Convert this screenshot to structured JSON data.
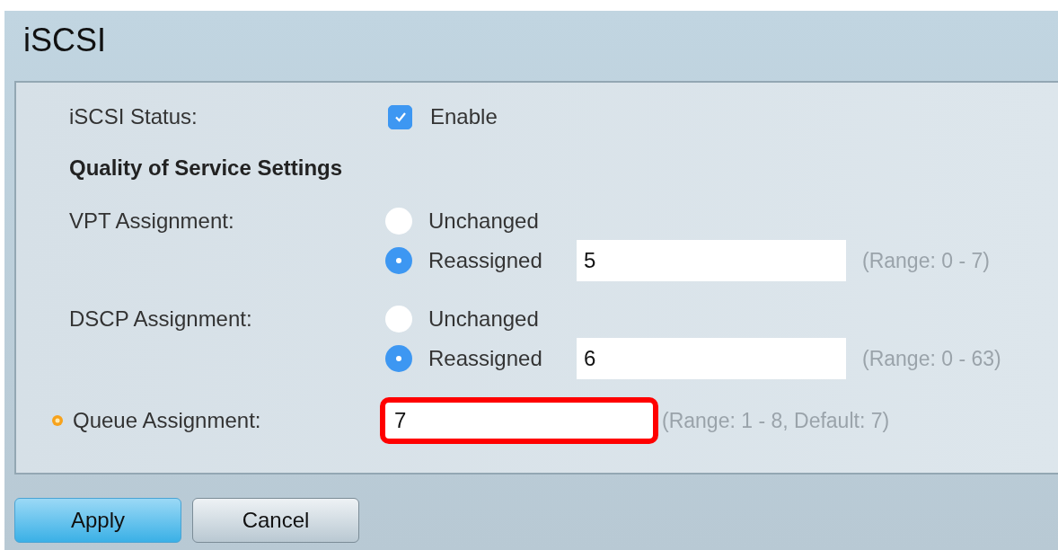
{
  "title": "iSCSI",
  "status": {
    "label": "iSCSI Status:",
    "option": "Enable",
    "checked": true
  },
  "section_heading": "Quality of Service Settings",
  "assignments": [
    {
      "label": "VPT Assignment:",
      "options": [
        {
          "label": "Unchanged",
          "selected": false
        },
        {
          "label": "Reassigned",
          "selected": true
        }
      ],
      "value": "5",
      "range": "(Range: 0 - 7)"
    },
    {
      "label": "DSCP Assignment:",
      "options": [
        {
          "label": "Unchanged",
          "selected": false
        },
        {
          "label": "Reassigned",
          "selected": true
        }
      ],
      "value": "6",
      "range": "(Range: 0 - 63)"
    }
  ],
  "queue": {
    "label": "Queue Assignment:",
    "required": true,
    "value": "7",
    "highlighted": true,
    "range": "(Range: 1 - 8, Default: 7)"
  },
  "buttons": [
    {
      "label": "Apply",
      "kind": "primary"
    },
    {
      "label": "Cancel",
      "kind": "secondary"
    }
  ]
}
